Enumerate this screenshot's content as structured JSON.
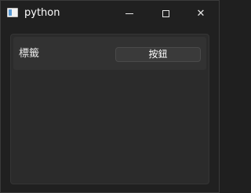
{
  "window": {
    "title": "python",
    "icon": "python-window-icon",
    "controls": {
      "minimize": "minimize-icon",
      "maximize": "maximize-icon",
      "close_glyph": "✕"
    }
  },
  "content": {
    "label": "標籤",
    "button_label": "按鈕"
  }
}
